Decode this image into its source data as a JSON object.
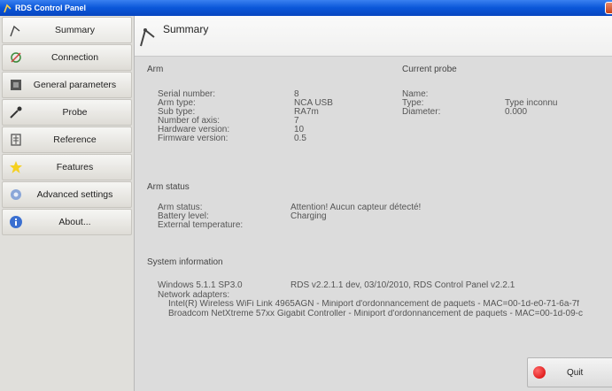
{
  "window": {
    "title": "RDS Control Panel"
  },
  "sidebar": {
    "items": [
      {
        "label": "Summary",
        "icon": "arm-icon"
      },
      {
        "label": "Connection",
        "icon": "connection-icon"
      },
      {
        "label": "General parameters",
        "icon": "parameters-icon"
      },
      {
        "label": "Probe",
        "icon": "probe-icon"
      },
      {
        "label": "Reference",
        "icon": "reference-icon"
      },
      {
        "label": "Features",
        "icon": "star-icon"
      },
      {
        "label": "Advanced settings",
        "icon": "advanced-settings-icon"
      },
      {
        "label": "About...",
        "icon": "info-icon"
      }
    ]
  },
  "header": {
    "title": "Summary"
  },
  "arm": {
    "section": "Arm",
    "labels": [
      "Serial number:",
      "Arm type:",
      "Sub type:",
      "Number of axis:",
      "Hardware version:",
      "Firmware version:"
    ],
    "values": [
      "8",
      "NCA USB",
      "RA7m",
      "7",
      "10",
      "0.5"
    ]
  },
  "probe": {
    "section": "Current probe",
    "labels": [
      "Name:",
      "Type:",
      "Diameter:"
    ],
    "values": [
      "",
      "Type inconnu",
      "0.000"
    ]
  },
  "status": {
    "section": "Arm status",
    "labels": [
      "Arm status:",
      "Battery level:",
      "External temperature:"
    ],
    "values": [
      "Attention! Aucun capteur détecté!",
      "Charging",
      ""
    ]
  },
  "system": {
    "section": "System information",
    "os": "Windows 5.1.1 SP3.0",
    "rds": "RDS v2.2.1.1 dev, 03/10/2010, RDS Control Panel v2.2.1",
    "adapters_label": "Network adapters:",
    "adapter1": "Intel(R) Wireless WiFi Link 4965AGN - Miniport d'ordonnancement de paquets - MAC=00-1d-e0-71-6a-7f",
    "adapter2": "Broadcom NetXtreme 57xx Gigabit Controller - Miniport d'ordonnancement de paquets - MAC=00-1d-09-c"
  },
  "quit": {
    "label": "Quit"
  },
  "colors": {
    "titlebar": "#0a56d8",
    "quit_dot": "#e00000"
  }
}
